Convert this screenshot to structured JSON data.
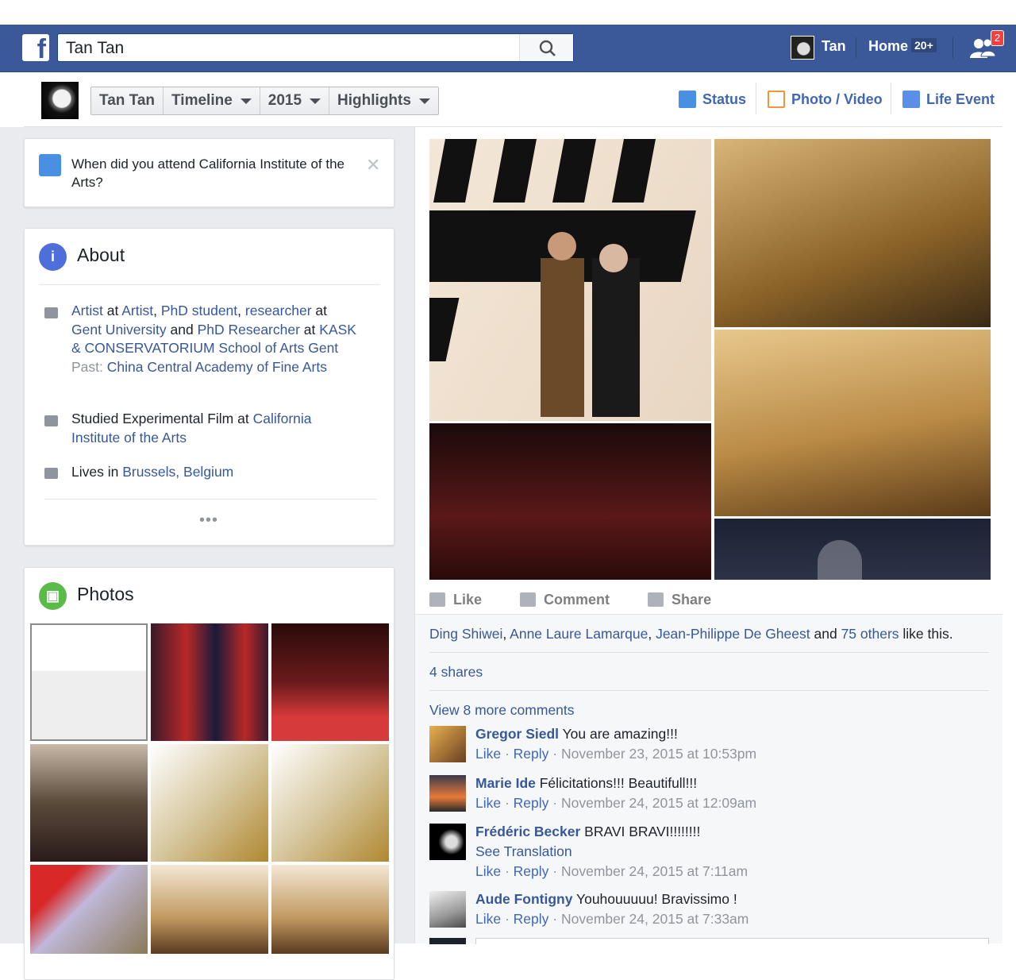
{
  "search": {
    "value": "Tan Tan"
  },
  "nav": {
    "user_name": "Tan",
    "home_label": "Home",
    "home_badge": "20+",
    "friend_requests_count": "2"
  },
  "subnav": {
    "crumbs": [
      "Tan Tan",
      "Timeline",
      "2015",
      "Highlights"
    ],
    "status_label": "Status",
    "photo_video_label": "Photo / Video",
    "life_event_label": "Life Event"
  },
  "question": {
    "text": "When did you attend California Institute of the Arts?",
    "close_glyph": "✕"
  },
  "about": {
    "title": "About",
    "work": {
      "role1": "Artist",
      "at1": " at ",
      "org1": "Artist",
      "comma": ", ",
      "role2": "PhD student",
      "comma2": ", ",
      "role3": "researcher",
      "at2": " at ",
      "org2": "Gent University",
      "and": " and ",
      "role4": "PhD Researcher",
      "at3": " at ",
      "org3": "KASK & CONSERVATORIUM School of Arts Gent",
      "past_label": "Past: ",
      "past_org": "China Central Academy of Fine Arts"
    },
    "education": {
      "prefix": "Studied Experimental Film at ",
      "school": "California Institute of the Arts"
    },
    "lives": {
      "prefix": "Lives in ",
      "city": "Brussels, Belgium"
    },
    "more": "•••"
  },
  "photos": {
    "title": "Photos"
  },
  "post": {
    "actions": {
      "like": "Like",
      "comment": "Comment",
      "share": "Share"
    },
    "likes": {
      "name1": "Ding Shiwei",
      "sep1": ", ",
      "name2": "Anne Laure Lamarque",
      "sep2": ", ",
      "name3": "Jean-Philippe De Gheest",
      "and": " and ",
      "others": "75 others",
      "suffix": " like this."
    },
    "shares": "4 shares",
    "view_more": "View 8 more comments",
    "comments": [
      {
        "author": "Gregor Siedl",
        "text": " You are amazing!!!",
        "like": "Like",
        "reply": "Reply",
        "time": " · November 23, 2015 at 10:53pm"
      },
      {
        "author": "Marie Ide",
        "text": " Félicitations!!! Beautifull!!!",
        "like": "Like",
        "reply": "Reply",
        "time": " · November 24, 2015 at 12:09am"
      },
      {
        "author": "Frédéric Becker",
        "text": " BRAVI BRAVI!!!!!!!!",
        "see_translation": "See Translation",
        "like": "Like",
        "reply": "Reply",
        "time": " · November 24, 2015 at 7:11am"
      },
      {
        "author": "Aude Fontigny",
        "text": " Youhouuuuu! Bravissimo !",
        "like": "Like",
        "reply": "Reply",
        "time": " · November 24, 2015 at 7:33am"
      }
    ],
    "dot": " · "
  },
  "colors": {
    "brand": "#3b5998",
    "link": "#365899",
    "badge": "#fa3e3e"
  }
}
